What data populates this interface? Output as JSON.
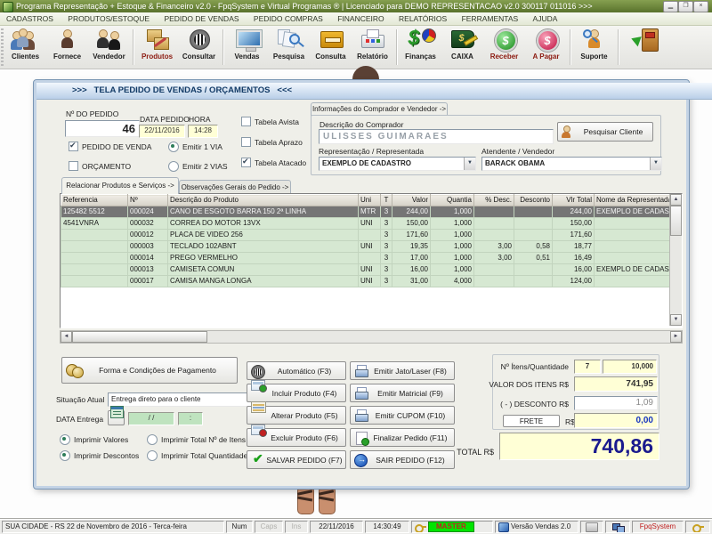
{
  "window": {
    "title": "Programa Representação + Estoque & Financeiro v2.0 - FpqSystem e Virtual Programas ® | Licenciado para  DEMO REPRESENTACAO v2.0 300117 011016 >>>"
  },
  "menubar": [
    "CADASTROS",
    "PRODUTOS/ESTOQUE",
    "PEDIDO DE VENDAS",
    "PEDIDO COMPRAS",
    "FINANCEIRO",
    "RELATÓRIOS",
    "FERRAMENTAS",
    "AJUDA"
  ],
  "toolbar": {
    "items": [
      "Clientes",
      "Fornece",
      "Vendedor",
      "Produtos",
      "Consultar",
      "Vendas",
      "Pesquisa",
      "Consulta",
      "Relatório",
      "Finanças",
      "CAIXA",
      "Receber",
      "A Pagar",
      "Suporte"
    ]
  },
  "dialog": {
    "title": ">>>   TELA PEDIDO DE VENDAS / ORÇAMENTOS   <<<",
    "order": {
      "numero_label": "Nº DO PEDIDO",
      "numero": "46",
      "data_label": "DATA PEDIDO",
      "data": "22/11/2016",
      "hora_label": "HORA",
      "hora": "14:28",
      "pedido_venda": "PEDIDO DE VENDA",
      "orcamento": "ORÇAMENTO",
      "via1": "Emitir 1 VIA",
      "via2": "Emitir 2 VIAS",
      "tab_avista": "Tabela Avista",
      "tab_aprazo": "Tabela Aprazo",
      "tab_atacado": "Tabela Atacado"
    },
    "comprador": {
      "tab": "Informações do Comprador e Vendedor ->",
      "desc_label": "Descrição do Comprador",
      "nome": "ULISSES GUIMARAES",
      "pesquisar_btn": "Pesquisar Cliente",
      "rep_label": "Representação / Representada",
      "rep_value": "EXEMPLO DE CADASTRO",
      "atend_label": "Atendente / Vendedor",
      "atend_value": "BARACK OBAMA"
    },
    "tabs": {
      "produtos": "Relacionar Produtos e Serviços ->",
      "observacoes": "Observações Gerais do Pedido ->"
    },
    "grid": {
      "columns": [
        "Referencia",
        "Nº",
        "Descrição do Produto",
        "Uni",
        "T",
        "Valor",
        "Quantia",
        "% Desc.",
        "Desconto",
        "Vlr Total",
        "Nome da Representada"
      ],
      "rows": [
        [
          "125482 5512",
          "000024",
          "CANO DE ESGOTO BARRA 150 2ª LINHA",
          "MTR",
          "3",
          "244,00",
          "1,000",
          "",
          "",
          "244,00",
          "EXEMPLO DE CADASTRO"
        ],
        [
          "4541VNRA",
          "000032",
          "CORREA DO MOTOR 13VX",
          "UNI",
          "3",
          "150,00",
          "1,000",
          "",
          "",
          "150,00",
          ""
        ],
        [
          "",
          "000012",
          "PLACA DE VIDEO 256",
          "",
          "3",
          "171,60",
          "1,000",
          "",
          "",
          "171,60",
          ""
        ],
        [
          "",
          "000003",
          "TECLADO 102ABNT",
          "UNI",
          "3",
          "19,35",
          "1,000",
          "3,00",
          "0,58",
          "18,77",
          ""
        ],
        [
          "",
          "000014",
          "PREGO VERMELHO",
          "",
          "3",
          "17,00",
          "1,000",
          "3,00",
          "0,51",
          "16,49",
          ""
        ],
        [
          "",
          "000013",
          "CAMISETA COMUN",
          "UNI",
          "3",
          "16,00",
          "1,000",
          "",
          "",
          "16,00",
          "EXEMPLO DE CADASTRO"
        ],
        [
          "",
          "000017",
          "CAMISA MANGA LONGA",
          "UNI",
          "3",
          "31,00",
          "4,000",
          "",
          "",
          "124,00",
          ""
        ]
      ]
    },
    "pagamento": {
      "btn": "Forma e Condições de Pagamento",
      "situacao_label": "Situação Atual",
      "situacao_value": "Entrega direto para o cliente",
      "entrega_label": "DATA Entrega",
      "entrega_data": "/ /",
      "entrega_hora": ":"
    },
    "impressao": {
      "valores": "Imprimir Valores",
      "descontos": "Imprimir Descontos",
      "total_itens": "Imprimir Total Nº de Itens",
      "total_qtd": "Imprimir Total Quantidade"
    },
    "botoes": {
      "f3": "Automático   (F3)",
      "f4": "Incluir Produto  (F4)",
      "f5": "Alterar Produto  (F5)",
      "f6": "Excluir Produto  (F6)",
      "f7": "SALVAR PEDIDO (F7)",
      "f8": "Emitir Jato/Laser (F8)",
      "f9": "Emitir Matricial  (F9)",
      "f10": "Emitir CUPOM  (F10)",
      "f11": "Finalizar Pedido  (F11)",
      "f12": "SAIR  PEDIDO  (F12)"
    },
    "totais": {
      "itens_label": "Nº Ítens/Quantidade",
      "itens": "7",
      "quantidade": "10,000",
      "valor_label": "VALOR DOS ITENS R$",
      "valor": "741,95",
      "desconto_label": "( - ) DESCONTO R$",
      "desconto": "1,09",
      "frete_btn": "FRETE",
      "rs": "R$",
      "frete": "0,00",
      "total_label": "TOTAL R$",
      "total": "740,86"
    }
  },
  "statusbar": {
    "local": "SUA CIDADE - RS 22 de Novembro de 2016 - Terca-feira",
    "num": "Num",
    "caps": "Caps",
    "ins": "Ins",
    "data": "22/11/2016",
    "hora": "14:30:49",
    "master": "MASTER",
    "versao": "Versão Vendas 2.0",
    "brand": "FpqSystem"
  }
}
